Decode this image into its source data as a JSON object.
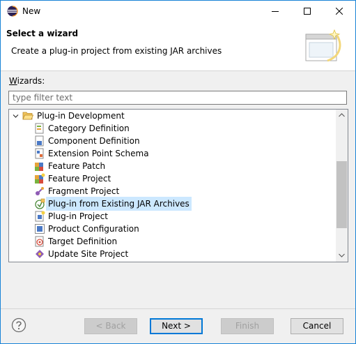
{
  "window": {
    "title": "New"
  },
  "header": {
    "title": "Select a wizard",
    "description": "Create a plug-in project from existing JAR archives"
  },
  "wizards": {
    "label": "Wizards:",
    "filter_placeholder": "type filter text",
    "filter_value": "",
    "category": "Plug-in Development",
    "items": [
      {
        "label": "Category Definition",
        "icon": "category-definition-icon"
      },
      {
        "label": "Component Definition",
        "icon": "component-definition-icon"
      },
      {
        "label": "Extension Point Schema",
        "icon": "extension-point-schema-icon"
      },
      {
        "label": "Feature Patch",
        "icon": "feature-patch-icon"
      },
      {
        "label": "Feature Project",
        "icon": "feature-project-icon"
      },
      {
        "label": "Fragment Project",
        "icon": "fragment-project-icon"
      },
      {
        "label": "Plug-in from Existing JAR Archives",
        "icon": "plugin-from-jar-icon",
        "selected": true
      },
      {
        "label": "Plug-in Project",
        "icon": "plugin-project-icon"
      },
      {
        "label": "Product Configuration",
        "icon": "product-configuration-icon"
      },
      {
        "label": "Target Definition",
        "icon": "target-definition-icon"
      },
      {
        "label": "Update Site Project",
        "icon": "update-site-project-icon"
      }
    ]
  },
  "buttons": {
    "back": "< Back",
    "next": "Next >",
    "finish": "Finish",
    "cancel": "Cancel"
  },
  "colors": {
    "selection": "#cce8ff",
    "default_button_border": "#0078d7",
    "window_border": "#1883d7"
  }
}
